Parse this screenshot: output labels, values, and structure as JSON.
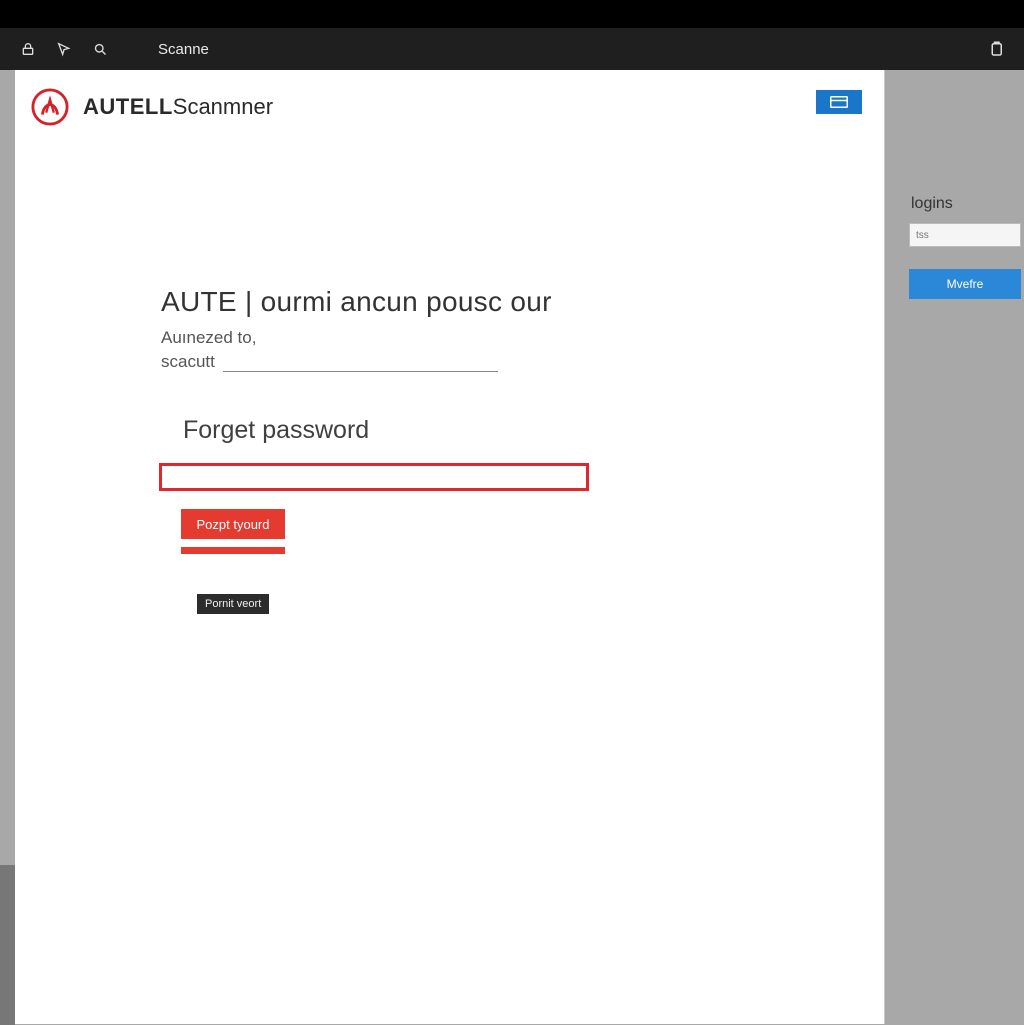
{
  "topbar": {
    "tab_label": "Scanne"
  },
  "brand": {
    "bold": "AUTELL",
    "rest": "Scanmner"
  },
  "content": {
    "heading": "AUTE  | ourmi ancun pousc our",
    "sub1": "Auınezed to,",
    "sub2": "scacutt",
    "fp_title": "Forget password",
    "red_button": "Pozpt tyourd",
    "dark_badge": "Pornit veort"
  },
  "sidebar": {
    "title": "logins",
    "input_placeholder": "tss",
    "button": "Mvefre"
  },
  "colors": {
    "accent_red": "#e1272d",
    "button_red": "#e53a2f",
    "blue": "#1976c9",
    "side_blue": "#2b88d8"
  }
}
